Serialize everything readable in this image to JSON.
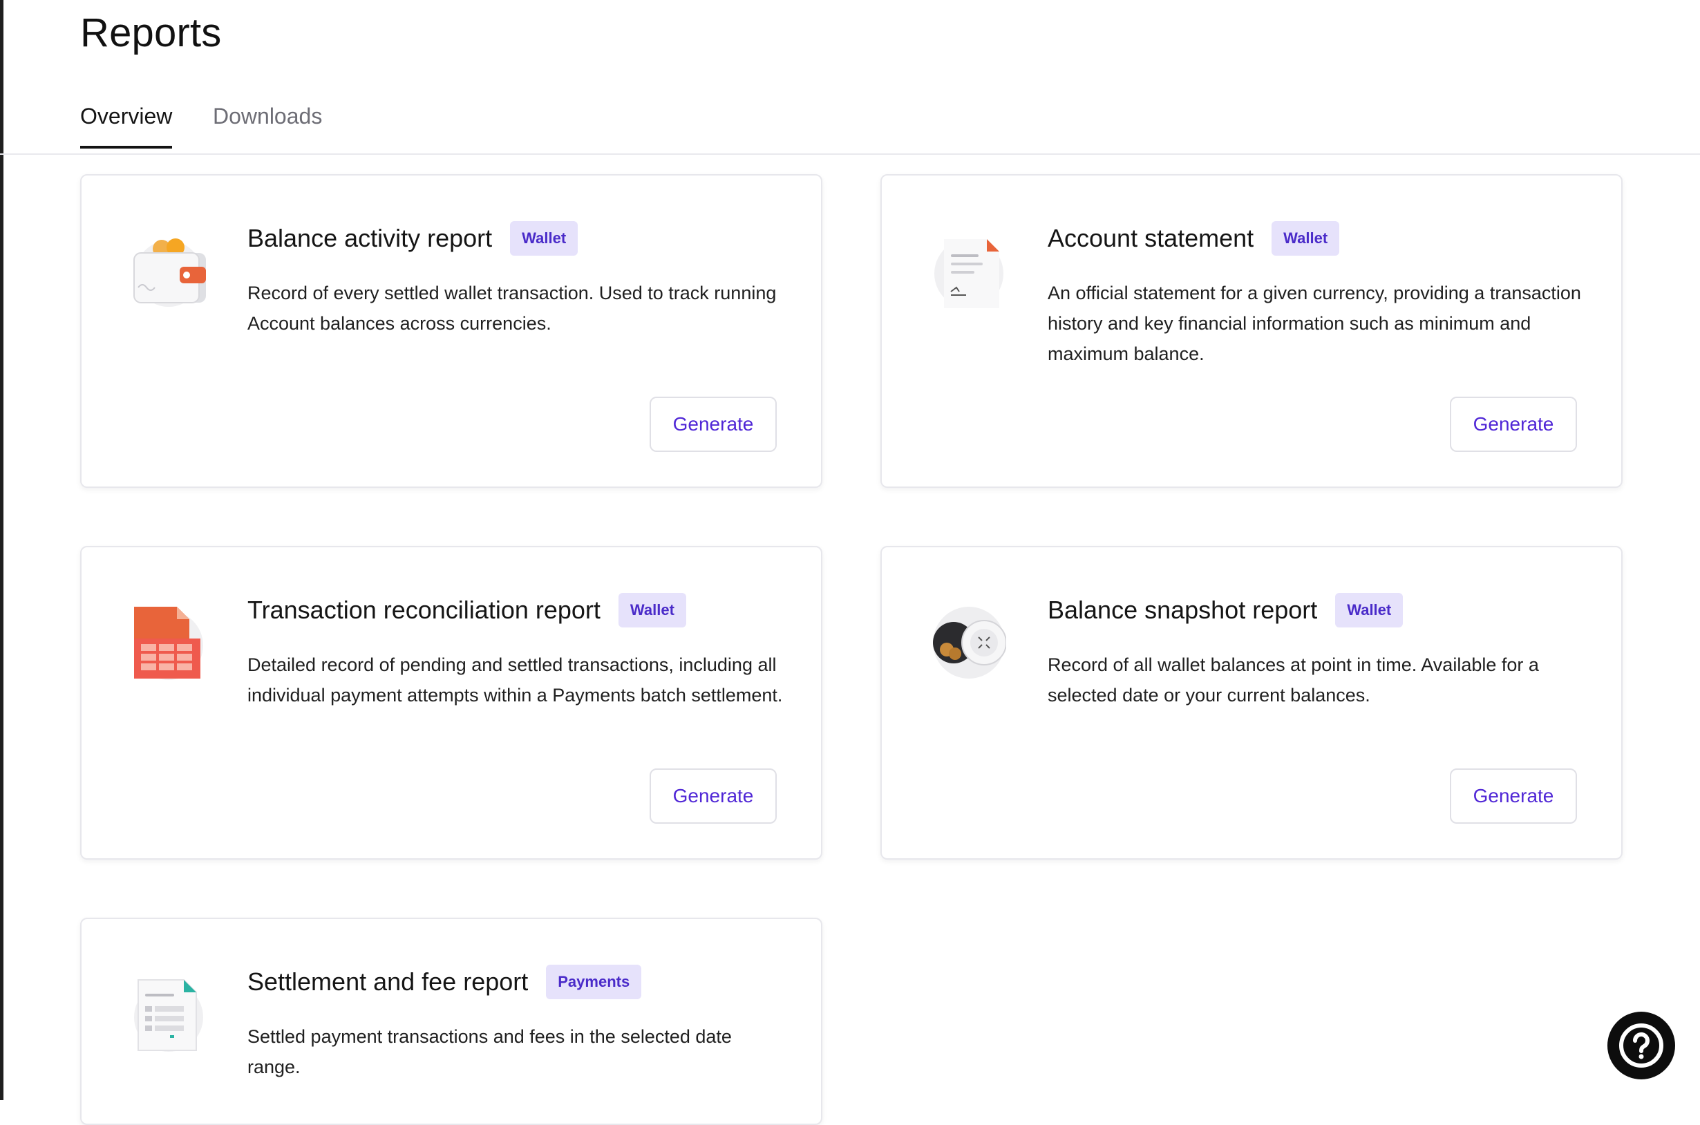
{
  "page": {
    "title": "Reports"
  },
  "tabs": [
    {
      "label": "Overview",
      "active": true
    },
    {
      "label": "Downloads",
      "active": false
    }
  ],
  "cards": [
    {
      "title": "Balance activity report",
      "badge": "Wallet",
      "description": "Record of every settled wallet transaction. Used to track running Account balances across currencies.",
      "button": "Generate",
      "icon": "wallet-icon"
    },
    {
      "title": "Account statement",
      "badge": "Wallet",
      "description": "An official statement for a given currency, providing a transaction history and key financial information such as minimum and maximum balance.",
      "button": "Generate",
      "icon": "document-icon"
    },
    {
      "title": "Transaction reconciliation report",
      "badge": "Wallet",
      "description": "Detailed record of pending and settled transactions, including all individual payment attempts within a Payments batch settlement.",
      "button": "Generate",
      "icon": "spreadsheet-icon"
    },
    {
      "title": "Balance snapshot report",
      "badge": "Wallet",
      "description": "Record of all wallet balances at point in time. Available for a selected date or your current balances.",
      "button": "Generate",
      "icon": "camera-snapshot-icon"
    },
    {
      "title": "Settlement and fee report",
      "badge": "Payments",
      "description": "Settled payment transactions and fees in the selected date range.",
      "icon": "fee-document-icon"
    }
  ],
  "help": {
    "icon": "help-icon"
  },
  "colors": {
    "accent": "#5027d6",
    "badge_bg": "#e6e2fb",
    "badge_text": "#4a2bc9"
  }
}
